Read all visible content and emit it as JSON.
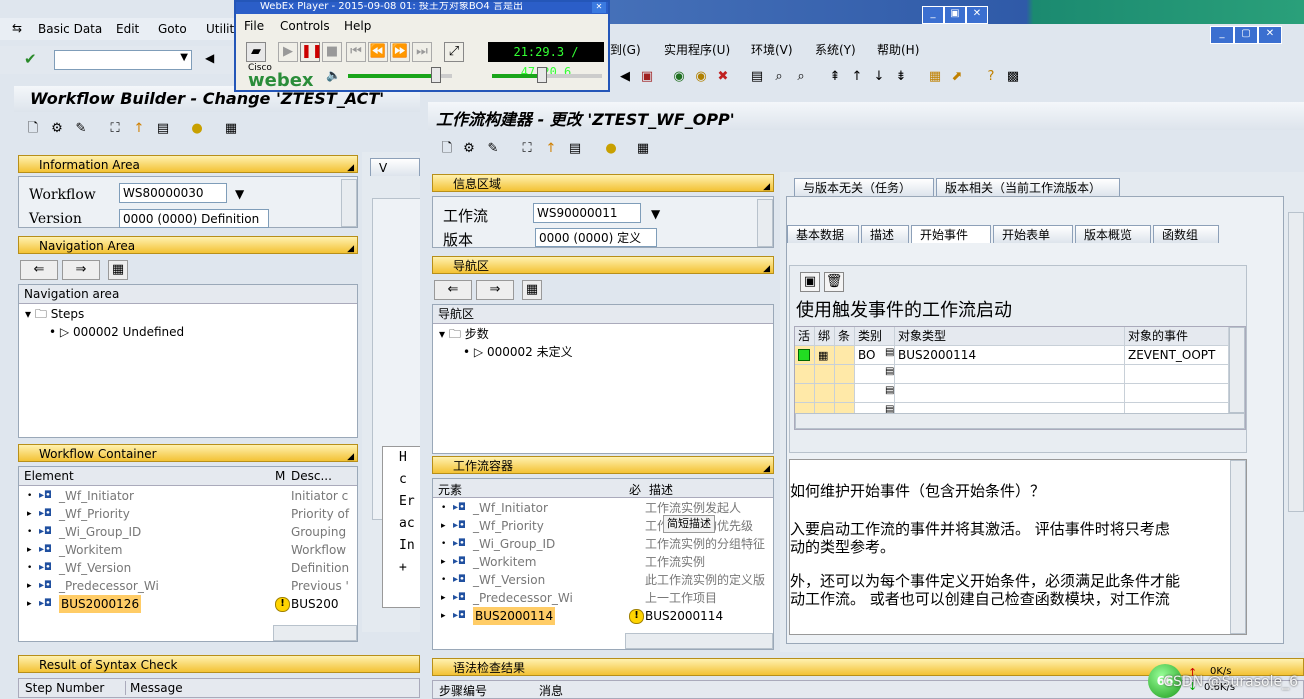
{
  "back_window": {
    "menu": [
      "Basic Data",
      "Edit",
      "Goto",
      "Utiliti"
    ],
    "title": "Workflow Builder - Change 'ZTEST_ACT'",
    "info_area": "Information Area",
    "workflow_label": "Workflow",
    "workflow_value": "WS80000030",
    "version_label": "Version",
    "version_value": "0000 (0000) Definition",
    "nav_area_bar": "Navigation Area",
    "nav_area_header": "Navigation area",
    "nav_steps": "Steps",
    "nav_step_item": "000002 Undefined",
    "container_bar": "Workflow Container",
    "col_element": "Element",
    "col_m": "M",
    "col_desc": "Desc...",
    "container_rows": [
      {
        "name": "_Wf_Initiator",
        "desc": "Initiator c"
      },
      {
        "name": "_Wf_Priority",
        "desc": "Priority of"
      },
      {
        "name": "_Wi_Group_ID",
        "desc": "Grouping"
      },
      {
        "name": "_Workitem",
        "desc": "Workflow"
      },
      {
        "name": "_Wf_Version",
        "desc": "Definition"
      },
      {
        "name": "_Predecessor_Wi",
        "desc": "Previous '"
      },
      {
        "name": "BUS2000126",
        "desc": "BUS200"
      }
    ],
    "syntax_bar": "Result of Syntax Check",
    "step_number": "Step Number",
    "message": "Message",
    "partial_text": [
      "H",
      "c",
      "Er",
      "ac",
      "In",
      "+"
    ],
    "tab_fragment": "V"
  },
  "webex": {
    "title": "WebEx Player - 2015-09-08 01: 投王方对象BO4 言是出",
    "menu": [
      "File",
      "Controls",
      "Help"
    ],
    "time": "21:29.3 / 47:20.6",
    "brand_small": "Cisco",
    "brand": "webex",
    "volume_level": 0.85,
    "progress_level": 0.45
  },
  "front_window": {
    "menu": [
      "到(G)",
      "实用程序(U)",
      "环境(V)",
      "系统(Y)",
      "帮助(H)"
    ],
    "title": "工作流构建器 - 更改 'ZTEST_WF_OPP'",
    "info_area": "信息区域",
    "workflow_label": "工作流",
    "workflow_value": "WS90000011",
    "version_label": "版本",
    "version_value": "0000 (0000) 定义",
    "nav_area_bar": "导航区",
    "nav_area_header": "导航区",
    "nav_steps": "步数",
    "nav_step_item": "000002 未定义",
    "container_bar": "工作流容器",
    "col_element": "元素",
    "col_m": "必",
    "col_desc": "描述",
    "container_rows": [
      {
        "name": "_Wf_Initiator",
        "desc": "工作流实例发起人"
      },
      {
        "name": "_Wf_Priority",
        "desc": "工作流实例的优先级"
      },
      {
        "name": "_Wi_Group_ID",
        "desc": "工作流实例的分组特征"
      },
      {
        "name": "_Workitem",
        "desc": "工作流实例"
      },
      {
        "name": "_Wf_Version",
        "desc": "此工作流实例的定义版"
      },
      {
        "name": "_Predecessor_Wi",
        "desc": "上一工作项目"
      },
      {
        "name": "BUS2000114",
        "desc": "BUS2000114"
      }
    ],
    "tooltip": "简短描述",
    "syntax_bar": "语法检查结果",
    "step_number": "步骤编号",
    "message": "消息",
    "outer_tabs": [
      "与版本无关（任务）",
      "版本相关（当前工作流版本）"
    ],
    "inner_tabs": [
      "基本数据",
      "描述",
      "开始事件",
      "开始表单",
      "版本概览",
      "函数组"
    ],
    "active_inner_tab": "开始事件",
    "start_event_heading": "使用触发事件的工作流启动",
    "ev_cols": [
      "活",
      "绑",
      "条",
      "类别",
      "对象类型",
      "对象的事件"
    ],
    "ev_row": {
      "category": "BO",
      "object_type": "BUS2000114",
      "event": "ZEVENT_OOPT"
    },
    "help_lines": [
      "如何维护开始事件（包含开始条件）？",
      "入要启动工作流的事件并将其激活。 评估事件时将只考虑",
      "动的类型参考。",
      "外，还可以为每个事件定义开始条件，必须满足此条件才能",
      "动工作流。 或者也可以创建自己检查函数模块，对工作流"
    ]
  },
  "status": {
    "speed_up": "0K/s",
    "speed_down": "0.6K/s",
    "watermark": "CSDN @Surasole_6",
    "percent": "66"
  }
}
